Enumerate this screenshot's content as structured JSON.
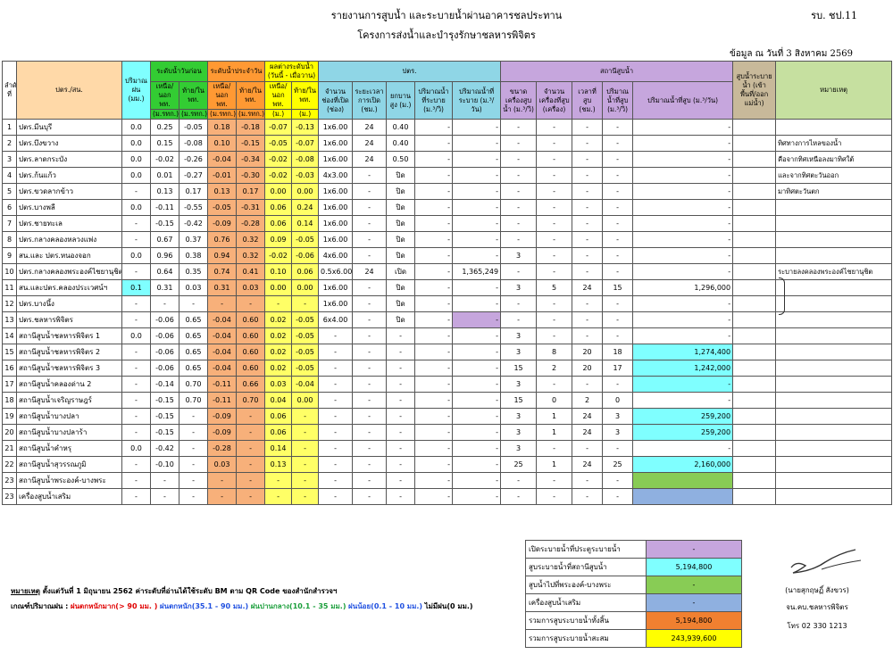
{
  "header": {
    "title": "รายงานการสูบน้ำ และระบายน้ำผ่านอาคารชลประทาน",
    "subtitle": "โครงการส่งน้ำและบำรุงรักษาชลหารพิจิตร",
    "form_no": "รบ. ชป.11",
    "as_of": "ข้อมูล ณ วันที่ 3 สิงหาคม 2569"
  },
  "columns": {
    "no": "ลำดับที่",
    "name": "ปตร./สน.",
    "rain": "ปริมาณฝน (มม.)",
    "prev": "ระดับน้ำวันก่อน",
    "day": "ระดับน้ำประจำวัน",
    "diff": "ผลต่างระดับน้ำ (วันนี้ - เมื่อวาน)",
    "gate": "ปตร.",
    "pump": "สถานีสูบน้ำ",
    "drain": "สูบน้ำระบายน้ำ (เข้าพื้นที่/ออกแม่น้ำ)",
    "note": "หมายเหตุ",
    "up": "เหนือ/นอก พท.",
    "down": "ท้าย/ใน พท.",
    "unit_msl": "(ม.รทก.)",
    "unit_m": "(ม.)",
    "gate_count": "จำนวนช่องที่เปิด (ช่อง)",
    "gate_hours": "ระยะเวลาการเปิด (ชม.)",
    "gate_lift": "ยกบานสูง (ม.)",
    "gate_flow": "ปริมาณน้ำที่ระบาย (ม.³/วิ)",
    "gate_vol": "ปริมาณน้ำที่ระบาย (ม.³/วัน)",
    "pump_size": "ขนาดเครื่องสูบน้ำ (ม.³/วิ)",
    "pump_count": "จำนวนเครื่องที่สูบ (เครื่อง)",
    "pump_hours": "เวลาที่สูบ (ชม.)",
    "pump_flow": "ปริมาณน้ำที่สูบ (ม.³/วิ)",
    "pump_vol": "ปริมาณน้ำที่สูบ (ม.³/วัน)"
  },
  "rows": [
    [
      "1",
      "ปตร.มีนบุรี",
      "0.0",
      "0.25",
      "-0.05",
      "0.18",
      "-0.18",
      "-0.07",
      "-0.13",
      "1x6.00",
      "24",
      "0.40",
      "-",
      "-",
      "-",
      "-",
      "-",
      "-",
      "-",
      "",
      ""
    ],
    [
      "2",
      "ปตร.บึงขวาง",
      "0.0",
      "0.15",
      "-0.08",
      "0.10",
      "-0.15",
      "-0.05",
      "-0.07",
      "1x6.00",
      "24",
      "0.40",
      "-",
      "-",
      "-",
      "-",
      "-",
      "-",
      "-",
      "",
      "ทิศทางการไหลของน้ำ"
    ],
    [
      "3",
      "ปตร.ลาดกระบัง",
      "0.0",
      "-0.02",
      "-0.26",
      "-0.04",
      "-0.34",
      "-0.02",
      "-0.08",
      "1x6.00",
      "24",
      "0.50",
      "-",
      "-",
      "-",
      "-",
      "-",
      "-",
      "-",
      "",
      "คือจากทิศเหนือลงมาทิศใต้"
    ],
    [
      "4",
      "ปตร.ก้นแก้ว",
      "0.0",
      "0.01",
      "-0.27",
      "-0.01",
      "-0.30",
      "-0.02",
      "-0.03",
      "4x3.00",
      "-",
      "ปิด",
      "-",
      "-",
      "-",
      "-",
      "-",
      "-",
      "-",
      "",
      "และจากทิศตะวันออก"
    ],
    [
      "5",
      "ปตร.ขวดลากข้าว",
      "-",
      "0.13",
      "0.17",
      "0.13",
      "0.17",
      "0.00",
      "0.00",
      "1x6.00",
      "-",
      "ปิด",
      "-",
      "-",
      "-",
      "-",
      "-",
      "-",
      "-",
      "",
      "มาทิศตะวันตก"
    ],
    [
      "6",
      "ปตร.บางพลี",
      "0.0",
      "-0.11",
      "-0.55",
      "-0.05",
      "-0.31",
      "0.06",
      "0.24",
      "1x6.00",
      "-",
      "ปิด",
      "-",
      "-",
      "-",
      "-",
      "-",
      "-",
      "-",
      "",
      ""
    ],
    [
      "7",
      "ปตร.ชายทะเล",
      "-",
      "-0.15",
      "-0.42",
      "-0.09",
      "-0.28",
      "0.06",
      "0.14",
      "1x6.00",
      "-",
      "ปิด",
      "-",
      "-",
      "-",
      "-",
      "-",
      "-",
      "-",
      "",
      ""
    ],
    [
      "8",
      "ปตร.กลางคลองหลวงแพ่ง",
      "-",
      "0.67",
      "0.37",
      "0.76",
      "0.32",
      "0.09",
      "-0.05",
      "1x6.00",
      "-",
      "ปิด",
      "-",
      "-",
      "-",
      "-",
      "-",
      "-",
      "-",
      "",
      ""
    ],
    [
      "9",
      "สน.และ ปตร.หนองจอก",
      "0.0",
      "0.96",
      "0.38",
      "0.94",
      "0.32",
      "-0.02",
      "-0.06",
      "4x6.00",
      "-",
      "ปิด",
      "-",
      "-",
      "3",
      "-",
      "-",
      "-",
      "-",
      "",
      ""
    ],
    [
      "10",
      "ปตร.กลางคลองพระองค์ไชยานุชิต",
      "-",
      "0.64",
      "0.35",
      "0.74",
      "0.41",
      "0.10",
      "0.06",
      "0.5x6.00",
      "24",
      "เปิด",
      "-",
      "1,365,249",
      "-",
      "-",
      "-",
      "-",
      "-",
      "",
      "ระบายลงคลองพระองค์ไชยานุชิต"
    ],
    [
      "11",
      "สน.และปตร.คลองประเวศน์ฯ",
      "0.1",
      "0.31",
      "0.03",
      "0.31",
      "0.03",
      "0.00",
      "0.00",
      "1x6.00",
      "-",
      "ปิด",
      "-",
      "-",
      "3",
      "5",
      "24",
      "15",
      "1,296,000",
      "",
      ""
    ],
    [
      "12",
      "ปตร.บางนึ้ง",
      "-",
      "-",
      "-",
      "-",
      "-",
      "-",
      "-",
      "1x6.00",
      "-",
      "ปิด",
      "-",
      "-",
      "-",
      "-",
      "-",
      "-",
      "-",
      "",
      ""
    ],
    [
      "13",
      "ปตร.ชลหารพิจิตร",
      "-",
      "-0.06",
      "0.65",
      "-0.04",
      "0.60",
      "0.02",
      "-0.05",
      "6x4.00",
      "-",
      "ปิด",
      "-",
      "-",
      "-",
      "-",
      "-",
      "-",
      "-",
      "",
      ""
    ],
    [
      "14",
      "สถานีสูบน้ำชลหารพิจิตร 1",
      "0.0",
      "-0.06",
      "0.65",
      "-0.04",
      "0.60",
      "0.02",
      "-0.05",
      "-",
      "-",
      "-",
      "-",
      "-",
      "3",
      "-",
      "-",
      "-",
      "-",
      "",
      ""
    ],
    [
      "15",
      "สถานีสูบน้ำชลหารพิจิตร 2",
      "-",
      "-0.06",
      "0.65",
      "-0.04",
      "0.60",
      "0.02",
      "-0.05",
      "-",
      "-",
      "-",
      "-",
      "-",
      "3",
      "8",
      "20",
      "18",
      "1,274,400",
      "",
      ""
    ],
    [
      "16",
      "สถานีสูบน้ำชลหารพิจิตร 3",
      "-",
      "-0.06",
      "0.65",
      "-0.04",
      "0.60",
      "0.02",
      "-0.05",
      "-",
      "-",
      "-",
      "-",
      "-",
      "15",
      "2",
      "20",
      "17",
      "1,242,000",
      "",
      ""
    ],
    [
      "17",
      "สถานีสูบน้ำคลองด่าน 2",
      "-",
      "-0.14",
      "0.70",
      "-0.11",
      "0.66",
      "0.03",
      "-0.04",
      "-",
      "-",
      "-",
      "-",
      "-",
      "3",
      "-",
      "-",
      "-",
      "-",
      "",
      ""
    ],
    [
      "18",
      "สถานีสูบน้ำเจริญราษฎร์",
      "-",
      "-0.15",
      "0.70",
      "-0.11",
      "0.70",
      "0.04",
      "0.00",
      "-",
      "-",
      "-",
      "-",
      "-",
      "15",
      "0",
      "2",
      "0",
      "-",
      "",
      ""
    ],
    [
      "19",
      "สถานีสูบน้ำบางปลา",
      "-",
      "-0.15",
      "-",
      "-0.09",
      "-",
      "0.06",
      "-",
      "-",
      "-",
      "-",
      "-",
      "-",
      "3",
      "1",
      "24",
      "3",
      "259,200",
      "",
      ""
    ],
    [
      "20",
      "สถานีสูบน้ำบางปลาร้า",
      "-",
      "-0.15",
      "-",
      "-0.09",
      "-",
      "0.06",
      "-",
      "-",
      "-",
      "-",
      "-",
      "-",
      "3",
      "1",
      "24",
      "3",
      "259,200",
      "",
      ""
    ],
    [
      "21",
      "สถานีสูบน้ำคำหรุ",
      "0.0",
      "-0.42",
      "-",
      "-0.28",
      "-",
      "0.14",
      "-",
      "-",
      "-",
      "-",
      "-",
      "-",
      "3",
      "-",
      "-",
      "-",
      "-",
      "",
      ""
    ],
    [
      "22",
      "สถานีสูบน้ำสุวรรณภูมิ",
      "-",
      "-0.10",
      "-",
      "0.03",
      "-",
      "0.13",
      "-",
      "-",
      "-",
      "-",
      "-",
      "-",
      "25",
      "1",
      "24",
      "25",
      "2,160,000",
      "",
      ""
    ],
    [
      "23",
      "สถานีสูบน้ำพระองค์-บางพระ",
      "-",
      "-",
      "-",
      "-",
      "-",
      "-",
      "-",
      "-",
      "-",
      "-",
      "-",
      "-",
      "-",
      "-",
      "-",
      "-",
      "",
      "",
      ""
    ],
    [
      "23",
      "เครื่องสูบน้ำเสริม",
      "-",
      "-",
      "-",
      "-",
      "-",
      "-",
      "-",
      "-",
      "-",
      "-",
      "-",
      "-",
      "-",
      "-",
      "-",
      "-",
      "",
      "",
      ""
    ]
  ],
  "summary": [
    {
      "label": "เปิดระบายน้ำที่ประตูระบายน้ำ",
      "value": "-",
      "color": "#c6a6dd"
    },
    {
      "label": "สูบระบายน้ำที่สถานีสูบน้ำ",
      "value": "5,194,800",
      "color": "#7fffff"
    },
    {
      "label": "สูบน้ำไปที่พระองค์-บางพระ",
      "value": "-",
      "color": "#88cc55"
    },
    {
      "label": "เครื่องสูบน้ำเสริม",
      "value": "-",
      "color": "#8fb0e0"
    },
    {
      "label": "รวมการสูบระบายน้ำทั้งสิ้น",
      "value": "5,194,800",
      "color": "#f08030"
    },
    {
      "label": "รวมการสูบระบายน้ำสะสม",
      "value": "243,939,600",
      "color": "#ffff00"
    }
  ],
  "remark": {
    "label": "หมายเหตุ",
    "text": " ตั้งแต่วันที่ 1  มิถุนายน  2562  ค่าระดับที่อ่านได้ใช้ระดับ BM  ตาม QR Code  ของสำนักสำรวจฯ",
    "rain_label": "เกณฑ์ปริมาณฝน :",
    "rain_heavy_plus": "ฝนตกหนักมาก(> 90 มม. )",
    "rain_heavy": "ฝนตกหนัก(35.1 - 90 มม.)",
    "rain_mid": "ฝนปานกลาง(10.1 - 35 มม.)",
    "rain_light": "ฝนน้อย(0.1 - 10 มม.)",
    "rain_none": "ไม่มีฝน(0 มม.)"
  },
  "signature": {
    "name": "(นายสุกฤษฏิ์  สังขวร)",
    "position": "จน.คบ.ชลหารพิจิตร",
    "phone": "โทร  02 330 1213"
  }
}
